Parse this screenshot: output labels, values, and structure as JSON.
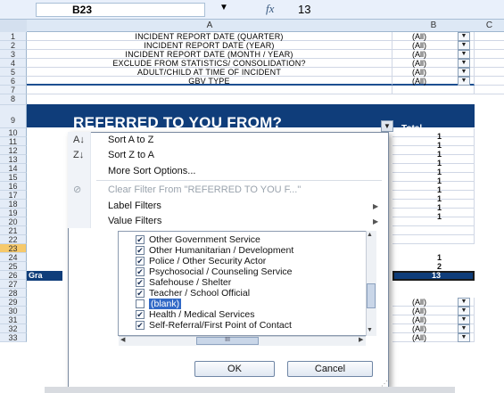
{
  "formula_bar": {
    "cell_ref": "B23",
    "fx": "fx",
    "value": "13"
  },
  "columns": [
    "A",
    "B",
    "C"
  ],
  "report_filters": [
    {
      "row": "1",
      "label": "INCIDENT REPORT DATE (QUARTER)",
      "value": "(All)"
    },
    {
      "row": "2",
      "label": "INCIDENT REPORT DATE (YEAR)",
      "value": "(All)"
    },
    {
      "row": "3",
      "label": "INCIDENT REPORT DATE (MONTH / YEAR)",
      "value": "(All)"
    },
    {
      "row": "4",
      "label": "EXCLUDE FROM STATISTICS/ CONSOLIDATION?",
      "value": "(All)"
    },
    {
      "row": "5",
      "label": "ADULT/CHILD AT TIME OF INCIDENT",
      "value": "(All)"
    },
    {
      "row": "6",
      "label": "GBV TYPE",
      "value": "(All)"
    }
  ],
  "pivot": {
    "row_field_title": "REFERRED TO YOU FROM?",
    "total_header": "Total",
    "grand_total_label": "Gra",
    "grand_total_value": "13",
    "totals": [
      "1",
      "1",
      "1",
      "1",
      "1",
      "1",
      "1",
      "1",
      "1",
      "1",
      "",
      "1",
      "2"
    ]
  },
  "lower_filters": [
    "(All)",
    "(All)",
    "(All)",
    "(All)",
    "(All)"
  ],
  "row_numbers": [
    "1",
    "2",
    "3",
    "4",
    "5",
    "6",
    "7",
    "8",
    "9",
    "10",
    "11",
    "12",
    "13",
    "14",
    "15",
    "16",
    "17",
    "18",
    "19",
    "20",
    "21",
    "22",
    "23",
    "24",
    "25",
    "26",
    "27",
    "28",
    "29",
    "30",
    "31",
    "32",
    "33"
  ],
  "filter_menu": {
    "sort_az": "Sort A to Z",
    "sort_za": "Sort Z to A",
    "more_sort": "More Sort Options...",
    "clear_filter": "Clear Filter From \"REFERRED TO YOU F...\"",
    "label_filters": "Label Filters",
    "value_filters": "Value Filters",
    "checklist": [
      {
        "label": "Other Government Service",
        "checked": true
      },
      {
        "label": "Other Humanitarian / Development",
        "checked": true
      },
      {
        "label": "Police / Other Security Actor",
        "checked": true
      },
      {
        "label": "Psychosocial / Counseling Service",
        "checked": true
      },
      {
        "label": "Safehouse / Shelter",
        "checked": true
      },
      {
        "label": "Teacher / School Official",
        "checked": true
      },
      {
        "label": "(blank)",
        "checked": false
      },
      {
        "label": "Health / Medical Services",
        "checked": true
      },
      {
        "label": "Self-Referral/First Point of Contact",
        "checked": true
      }
    ],
    "hscroll_thumb": "III",
    "ok_label": "OK",
    "cancel_label": "Cancel"
  },
  "icons": {
    "sort_az": "sort-ascending-icon",
    "sort_za": "sort-descending-icon",
    "clear_filter": "clear-filter-icon",
    "dropdown": "chevron-down-icon",
    "submenu": "submenu-arrow-icon"
  },
  "colors": {
    "pivot_header_bg": "#0f3d7a",
    "selection": "#3169c6",
    "row_header_bg": "#e4ecf7"
  }
}
